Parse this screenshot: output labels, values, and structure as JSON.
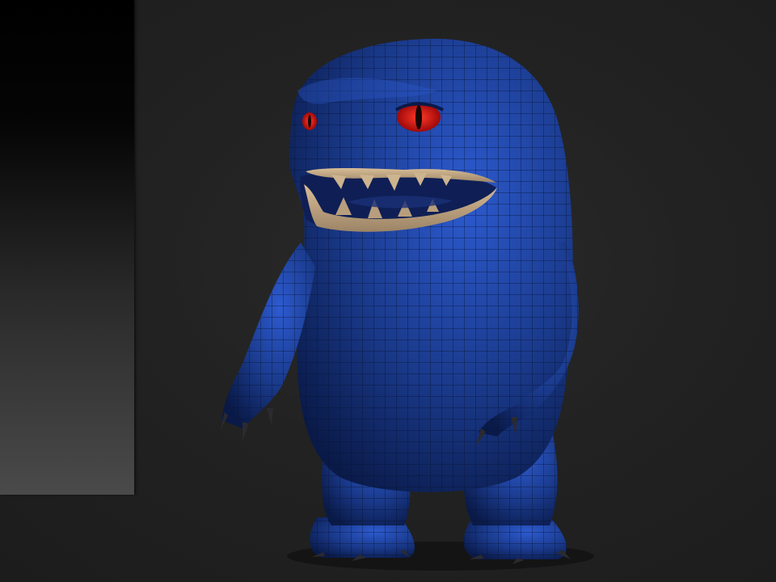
{
  "scene": {
    "subject": "creature-model",
    "colors": {
      "background": "#222222",
      "backdrop_panel": "#3a3a3a",
      "skin": "#1a3a8c",
      "skin_highlight": "#2d5bd0",
      "wireframe": "#0b1a45",
      "gums": "#c9ad8a",
      "eye": "#e01010",
      "pupil": "#1a0505",
      "claws": "#2a2a30"
    }
  }
}
